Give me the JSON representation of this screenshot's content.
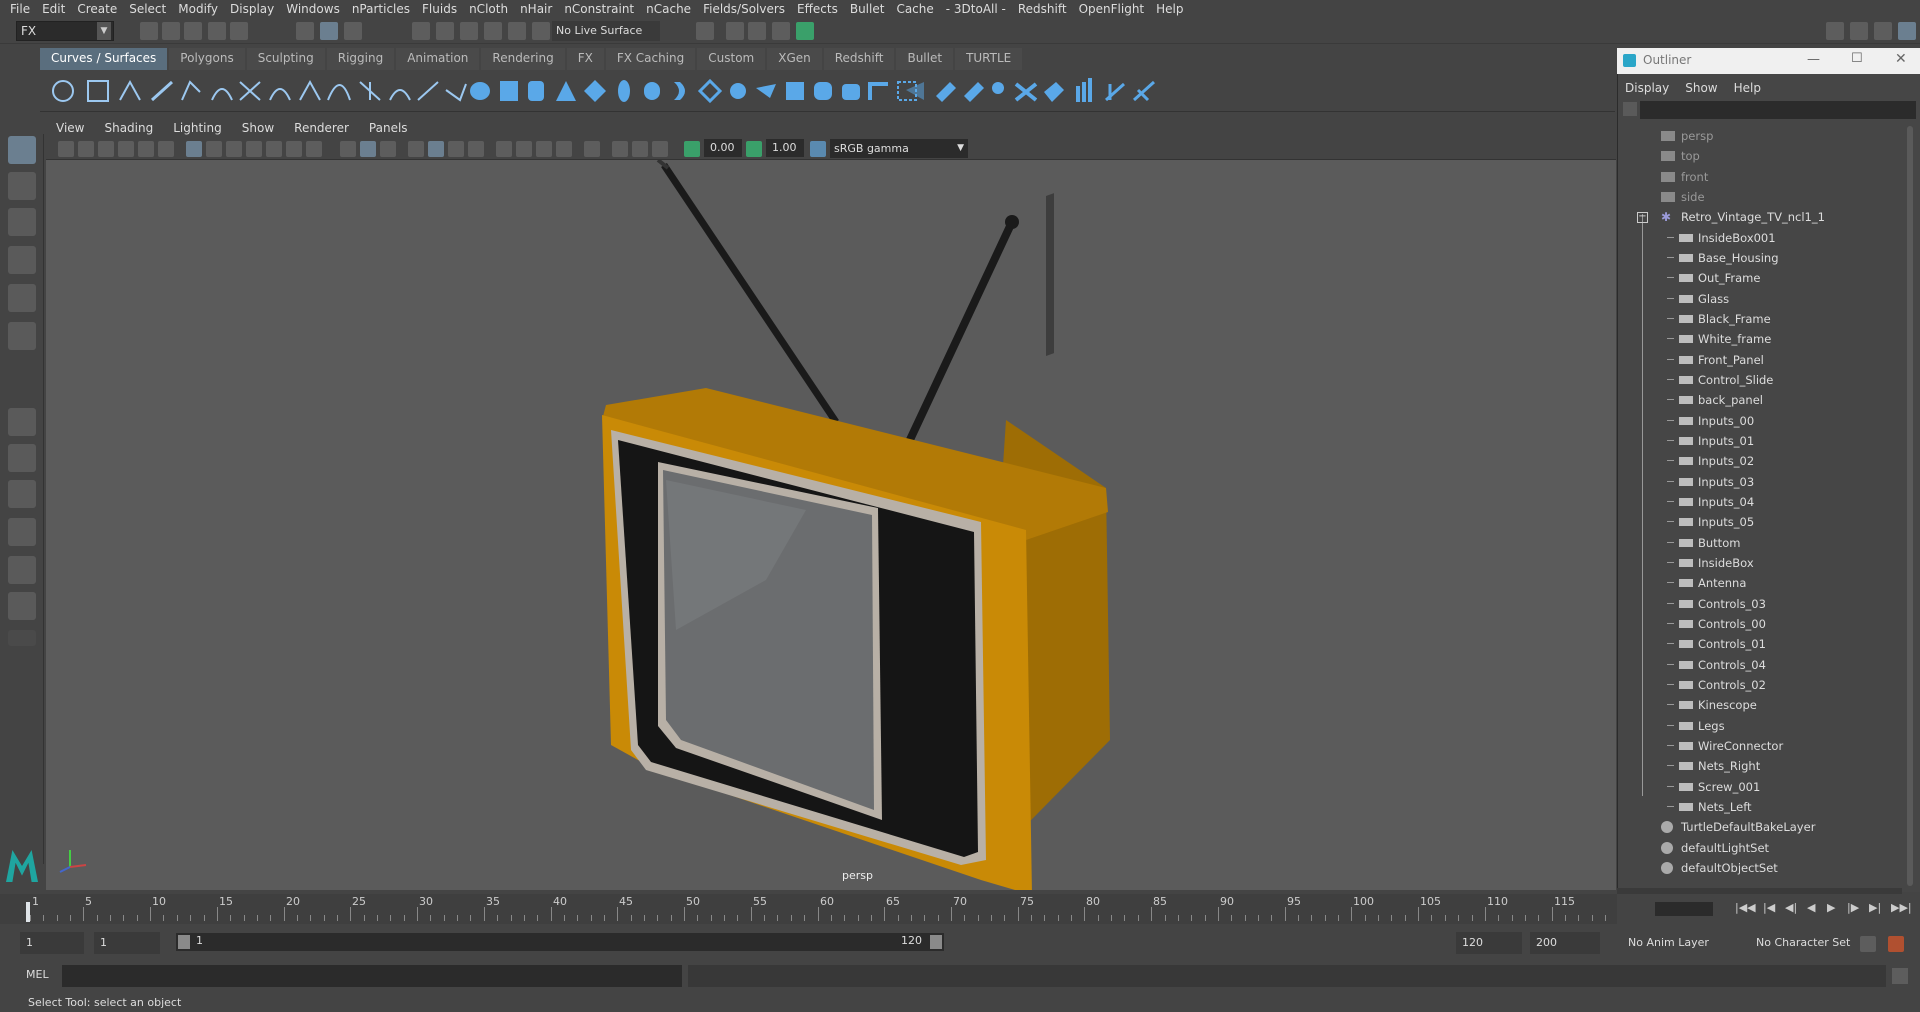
{
  "menubar": {
    "items": [
      "File",
      "Edit",
      "Create",
      "Select",
      "Modify",
      "Display",
      "Windows",
      "nParticles",
      "Fluids",
      "nCloth",
      "nHair",
      "nConstraint",
      "nCache",
      "Fields/Solvers",
      "Effects",
      "Bullet",
      "Cache",
      "- 3DtoAll -",
      "Redshift",
      "OpenFlight",
      "Help"
    ]
  },
  "status": {
    "mode": "FX",
    "live_surface": "No Live Surface"
  },
  "shelf": {
    "tabs": [
      "Curves / Surfaces",
      "Polygons",
      "Sculpting",
      "Rigging",
      "Animation",
      "Rendering",
      "FX",
      "FX Caching",
      "Custom",
      "XGen",
      "Redshift",
      "Bullet",
      "TURTLE"
    ],
    "active_tab": "Curves / Surfaces"
  },
  "viewport": {
    "menu": [
      "View",
      "Shading",
      "Lighting",
      "Show",
      "Renderer",
      "Panels"
    ],
    "exposure": "0.00",
    "gamma_value": "1.00",
    "color_space": "sRGB gamma",
    "camera_label": "persp"
  },
  "outliner": {
    "title": "Outliner",
    "menu": [
      "Display",
      "Show",
      "Help"
    ],
    "cameras": [
      "persp",
      "top",
      "front",
      "side"
    ],
    "group": "Retro_Vintage_TV_ncl1_1",
    "children": [
      "InsideBox001",
      "Base_Housing",
      "Out_Frame",
      "Glass",
      "Black_Frame",
      "White_frame",
      "Front_Panel",
      "Control_Slide",
      "back_panel",
      "Inputs_00",
      "Inputs_01",
      "Inputs_02",
      "Inputs_03",
      "Inputs_04",
      "Inputs_05",
      "Buttom",
      "InsideBox",
      "Antenna",
      "Controls_03",
      "Controls_00",
      "Controls_01",
      "Controls_04",
      "Controls_02",
      "Kinescope",
      "Legs",
      "WireConnector",
      "Nets_Right",
      "Screw_001",
      "Nets_Left"
    ],
    "sets": [
      "TurtleDefaultBakeLayer",
      "defaultLightSet",
      "defaultObjectSet"
    ]
  },
  "timeline": {
    "ticks": [
      "1",
      "5",
      "10",
      "15",
      "20",
      "25",
      "30",
      "35",
      "40",
      "45",
      "50",
      "55",
      "60",
      "65",
      "70",
      "75",
      "80",
      "85",
      "90",
      "95",
      "100",
      "105",
      "110",
      "115"
    ],
    "current_frame": "1"
  },
  "range": {
    "start": "1",
    "inner_start": "1",
    "slider_start": "1",
    "slider_end": "120",
    "end": "120",
    "outer_end": "200",
    "anim_layer": "No Anim Layer",
    "character_set": "No Character Set"
  },
  "cmd": {
    "label": "MEL"
  },
  "help": {
    "text": "Select Tool: select an object"
  },
  "colors": {
    "accent": "#5a6e7e",
    "tv_body": "#c98a06",
    "tv_screen": "#6b6d6f",
    "viewport_bg": "#5b5b5b"
  },
  "icons": {
    "window": [
      "minimize-icon",
      "maximize-icon",
      "close-icon"
    ]
  }
}
